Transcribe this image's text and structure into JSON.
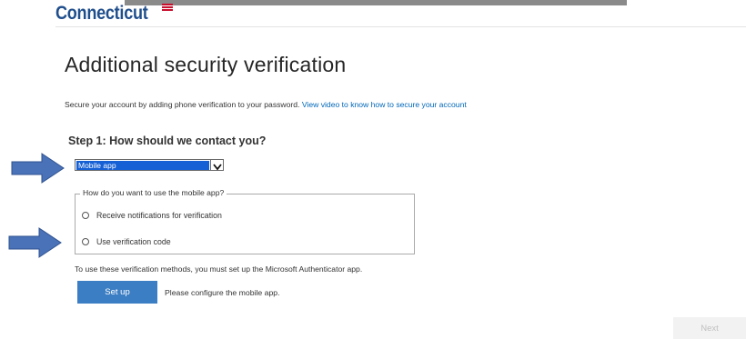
{
  "header": {
    "brand": "Connecticut"
  },
  "page": {
    "title": "Additional security verification",
    "intro_text": "Secure your account by adding phone verification to your password. ",
    "intro_link": "View video to know how to secure your account"
  },
  "step1": {
    "title": "Step 1: How should we contact you?",
    "contact_method": "Mobile app"
  },
  "mobile_app": {
    "legend": "How do you want to use the mobile app?",
    "options": [
      {
        "label": "Receive notifications for verification",
        "selected": false
      },
      {
        "label": "Use verification code",
        "selected": false
      }
    ]
  },
  "authenticator_note": "To use these verification methods, you must set up the Microsoft Authenticator app.",
  "setup": {
    "button_label": "Set up",
    "message": "Please configure the mobile app."
  },
  "footer": {
    "next_label": "Next"
  },
  "colors": {
    "brand": "#1f4e8c",
    "link": "#0067b8",
    "primary_button": "#3c7ec4",
    "select_highlight": "#1660d6",
    "annotation_arrow": "#4a72b8"
  },
  "annotations": {
    "arrow_icon": "right-arrow-icon"
  }
}
